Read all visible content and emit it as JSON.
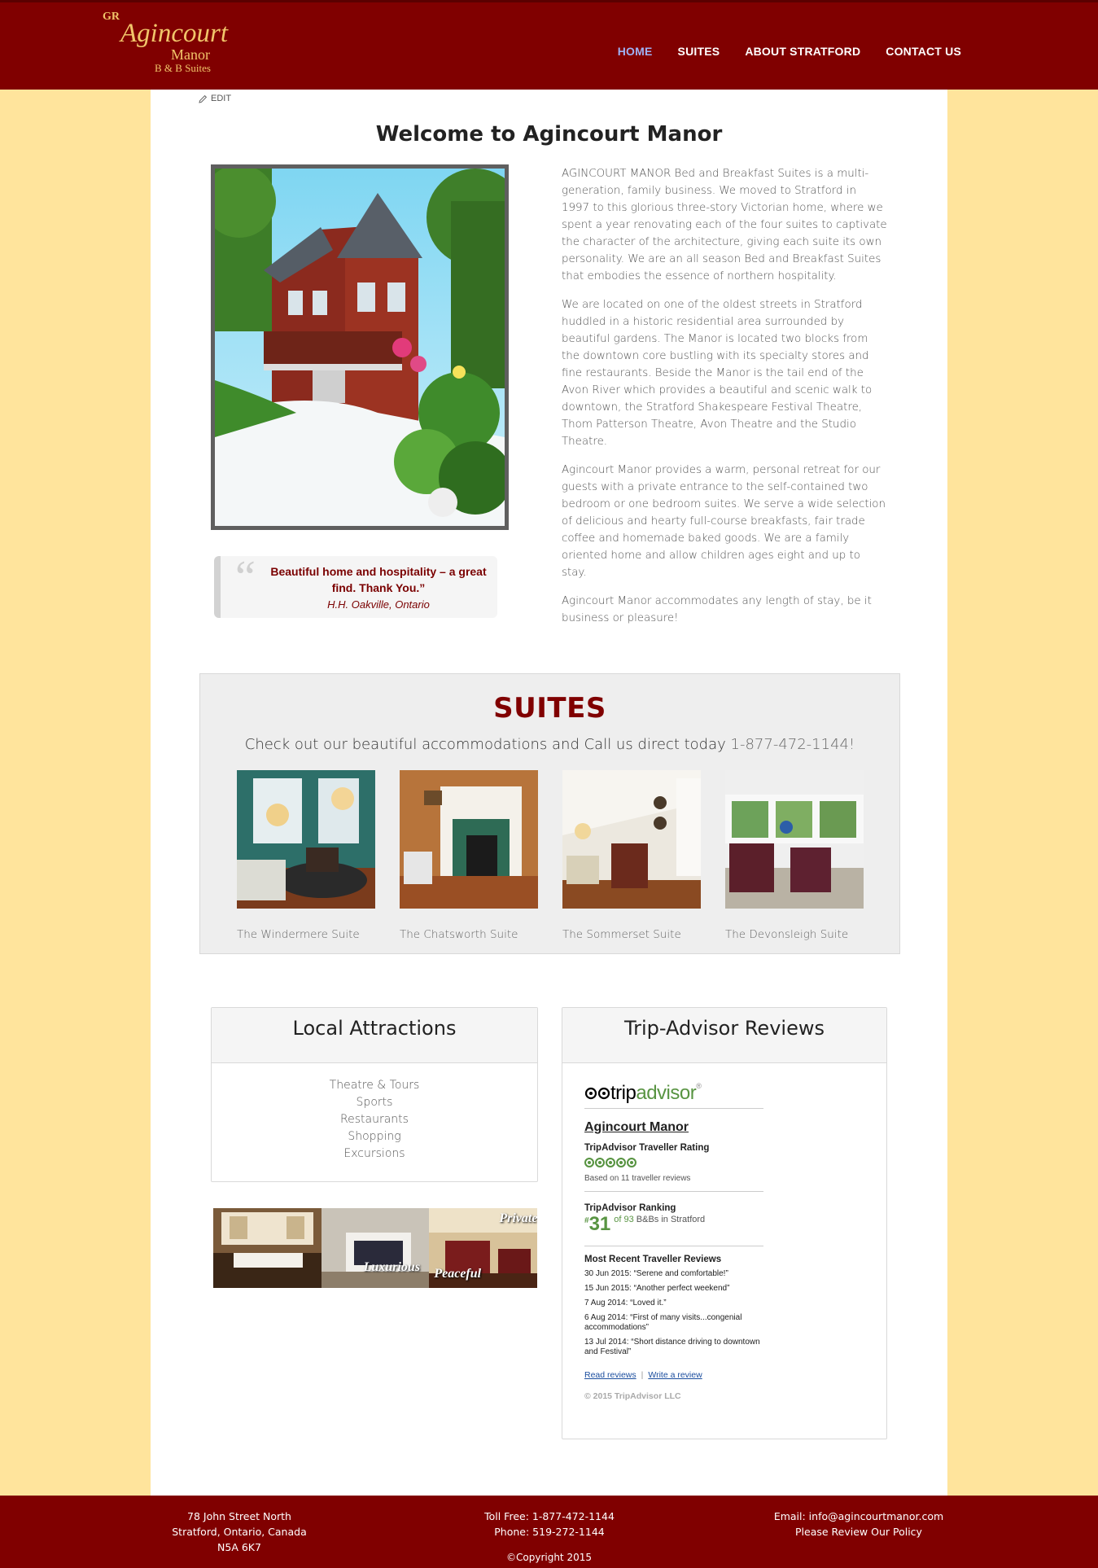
{
  "header": {
    "logo": {
      "mark": "GR",
      "line1": "Agincourt",
      "line2": "Manor",
      "line3": "B & B Suites"
    },
    "nav": [
      {
        "label": "HOME",
        "active": true
      },
      {
        "label": "SUITES",
        "active": false
      },
      {
        "label": "ABOUT STRATFORD",
        "active": false
      },
      {
        "label": "CONTACT US",
        "active": false
      }
    ]
  },
  "page": {
    "edit_label": "EDIT",
    "title": "Welcome to Agincourt Manor",
    "paragraphs": [
      "AGINCOURT MANOR Bed and Breakfast Suites is a multi-generation, family business. We moved to Stratford in 1997 to this glorious three-story Victorian home, where we spent a year renovating each of the four suites to captivate the character of the architecture, giving each suite its own personality. We are an all season Bed and Breakfast Suites that embodies the essence of northern hospitality.",
      "We are located on one of the oldest streets in Stratford huddled in a historic residential area surrounded by beautiful gardens. The Manor is located two blocks from the downtown core bustling with its specialty stores and fine restaurants. Beside the Manor is the tail end of the Avon River which provides a beautiful and scenic walk to downtown, the Stratford Shakespeare Festival Theatre, Thom Patterson Theatre, Avon Theatre and the Studio Theatre.",
      "Agincourt Manor provides a warm, personal retreat for our guests with a private entrance to the self-contained two bedroom or one bedroom suites. We serve a wide selection of delicious and hearty full-course breakfasts, fair trade coffee and homemade baked goods. We are a family oriented home and allow children ages eight and up to stay.",
      "Agincourt Manor accommodates any length of stay, be it business or pleasure!"
    ],
    "quote": {
      "text": "Beautiful home and hospitality – a great find. Thank You.”",
      "author": "H.H. Oakville, Ontario"
    }
  },
  "suites": {
    "title": "SUITES",
    "subtitle": "Check out our beautiful accommodations and Call us direct today ",
    "phone": "1-877-472-1144!",
    "items": [
      {
        "caption": "The Windermere Suite"
      },
      {
        "caption": "The Chatsworth Suite"
      },
      {
        "caption": "The Sommerset Suite"
      },
      {
        "caption": "The Devonsleigh Suite"
      }
    ]
  },
  "attractions": {
    "title": "Local Attractions",
    "items": [
      "Theatre & Tours",
      "Sports",
      "Restaurants",
      "Shopping",
      "Excursions"
    ]
  },
  "banner": {
    "words": [
      "Luxurious",
      "Peaceful",
      "Private"
    ]
  },
  "tripadvisor": {
    "title": "Trip-Advisor Reviews",
    "logo_trip": "trip",
    "logo_advisor": "advisor",
    "logo_mark": "®",
    "property": "Agincourt Manor",
    "rating_heading": "TripAdvisor Traveller Rating",
    "rating_bubbles": 5,
    "based_on": "Based on 11 traveller reviews",
    "ranking_heading": "TripAdvisor Ranking",
    "rank_hash": "#",
    "rank": "31",
    "rank_of": "of 93",
    "rank_text": " B&Bs in Stratford",
    "recent_heading": "Most Recent Traveller Reviews",
    "reviews": [
      "30 Jun 2015: “Serene and comfortable!”",
      "15 Jun 2015: “Another perfect weekend”",
      "7 Aug 2014: “Loved it.”",
      "6 Aug 2014: “First of many visits...congenial accommodations”",
      "13 Jul 2014: “Short distance driving to downtown and Festival”"
    ],
    "read_reviews": "Read reviews",
    "link_sep": "|",
    "write_review": "Write a review",
    "copyright": "© 2015 TripAdvisor LLC"
  },
  "footer": {
    "address": [
      "78 John Street North",
      "Stratford, Ontario, Canada",
      "N5A 6K7"
    ],
    "phones": [
      "Toll Free: 1-877-472-1144",
      "Phone: 519-272-1144"
    ],
    "contact": [
      "Email: info@agincourtmanor.com",
      "Please Review Our Policy"
    ],
    "copyright": "©Copyright 2015"
  },
  "colors": {
    "brand": "#800000",
    "page_bg": "#ffe49c",
    "nav_active": "#9fb2f5",
    "tripadvisor_green": "#589442"
  }
}
